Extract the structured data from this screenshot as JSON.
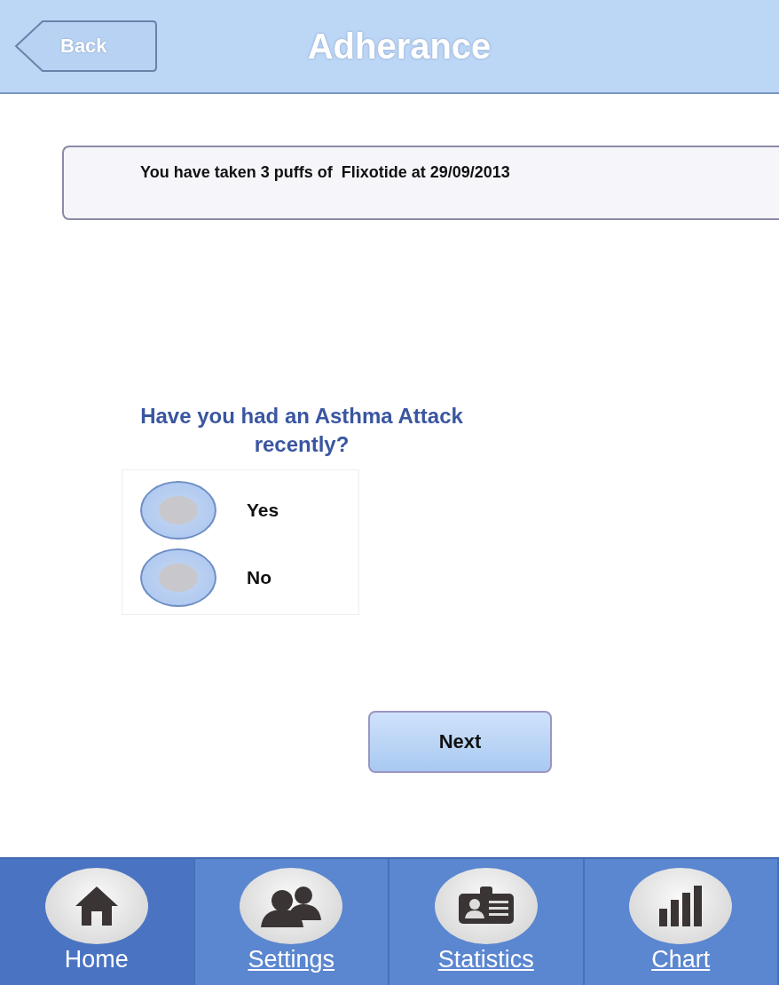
{
  "header": {
    "back": "Back",
    "title": "Adherance"
  },
  "message": "You have taken 3 puffs of  Flixotide at 29/09/2013",
  "question": "Have you had an Asthma Attack recently?",
  "options": [
    {
      "label": "Yes",
      "selected": false
    },
    {
      "label": "No",
      "selected": false
    }
  ],
  "next": "Next",
  "tabs": [
    {
      "label": "Home",
      "kind": "home",
      "selected": true
    },
    {
      "label": "Settings",
      "kind": "people",
      "selected": false
    },
    {
      "label": "Statistics",
      "kind": "card",
      "selected": false
    },
    {
      "label": "Chart",
      "kind": "chart",
      "selected": false
    }
  ]
}
